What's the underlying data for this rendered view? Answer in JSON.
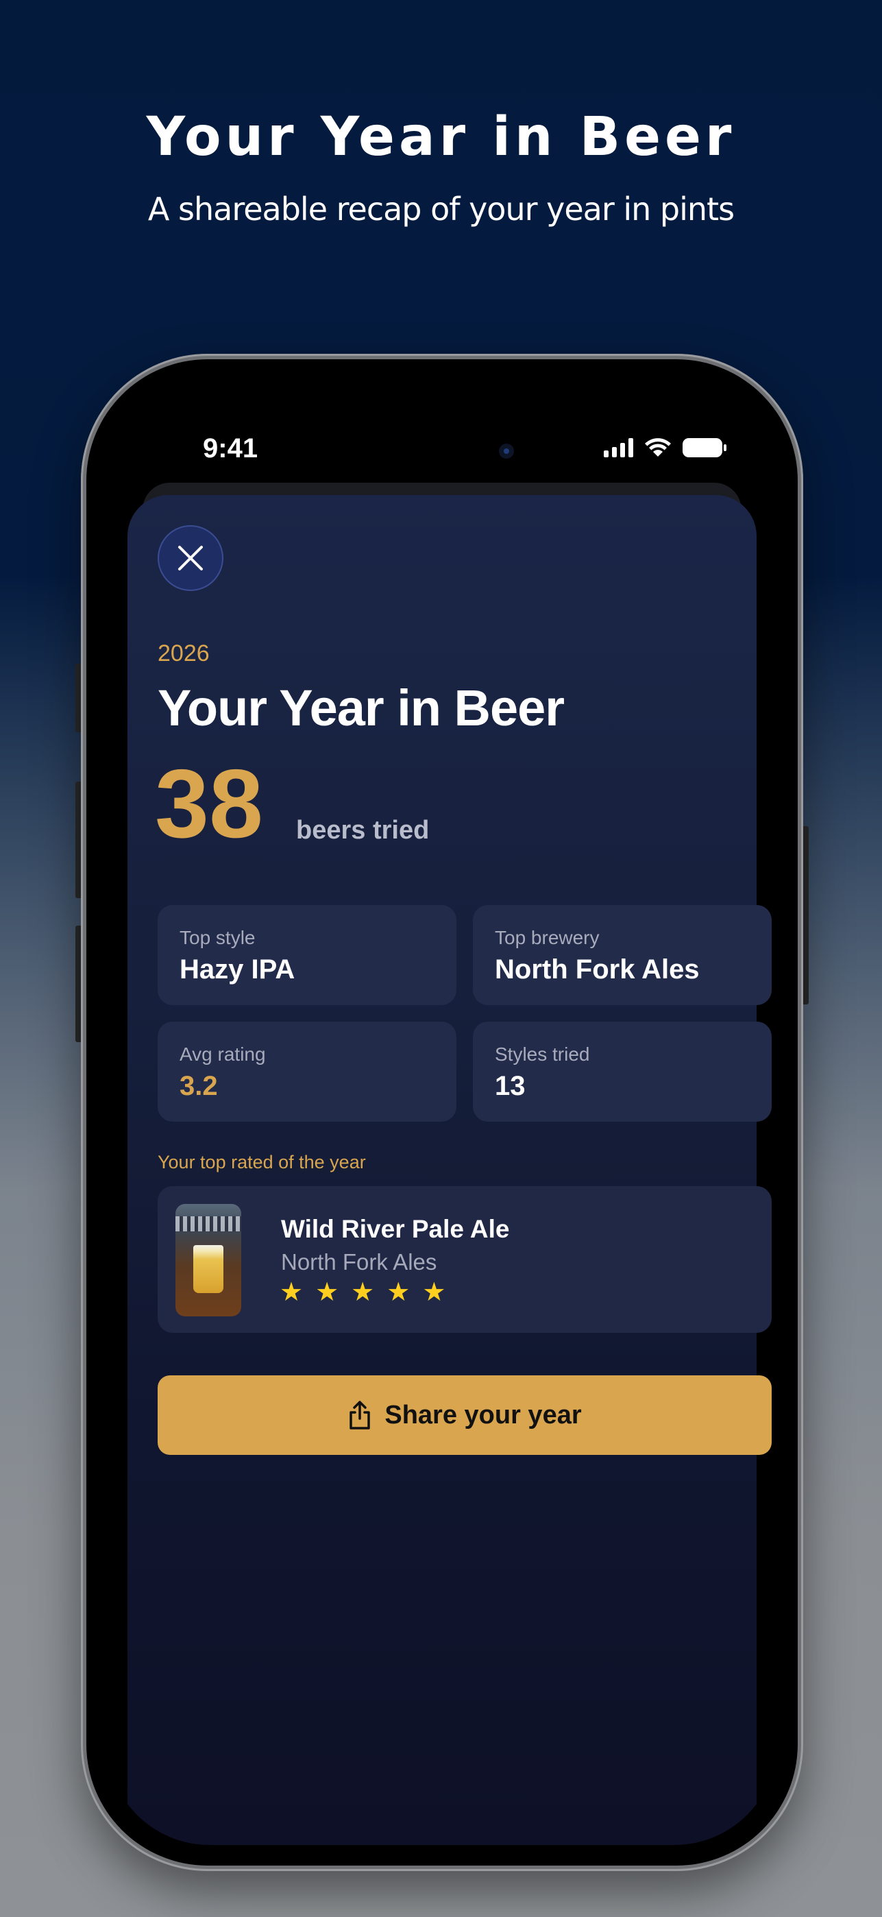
{
  "hero": {
    "title": "Your Year in Beer",
    "subtitle": "A shareable recap of your year in pints"
  },
  "status_bar": {
    "time": "9:41",
    "icons": [
      "cellular-signal-icon",
      "wifi-icon",
      "battery-icon"
    ]
  },
  "recap": {
    "close_icon": "close-icon",
    "year": "2026",
    "title": "Your Year in Beer",
    "beer_count": "38",
    "beer_count_label": "beers tried",
    "stats": [
      {
        "label": "Top style",
        "value": "Hazy IPA"
      },
      {
        "label": "Top brewery",
        "value": "North Fork Ales"
      },
      {
        "label": "Avg rating",
        "value": "3.2"
      },
      {
        "label": "Styles tried",
        "value": "13"
      }
    ],
    "top_rated": {
      "section_label": "Your top rated of the year",
      "name": "Wild River Pale Ale",
      "brewery": "North Fork Ales",
      "rating": 5,
      "rating_max": 5
    },
    "share_button": {
      "label": "Share your year",
      "icon": "share-icon"
    }
  },
  "colors": {
    "accent_gold": "#d9a64f",
    "star": "#ffcf1f",
    "sheet_background": "#16203c",
    "card_background": "#232b4b"
  }
}
